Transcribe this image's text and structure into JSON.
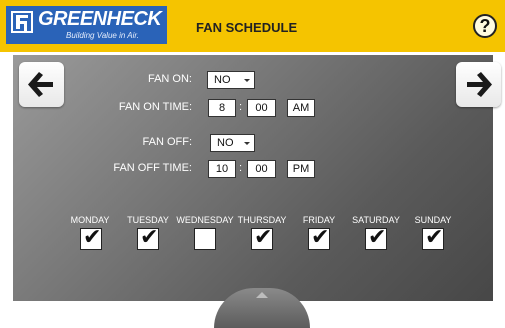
{
  "header": {
    "brand": "GREENHECK",
    "tagline": "Building Value in Air.",
    "title": "FAN SCHEDULE",
    "help_label": "?"
  },
  "colors": {
    "header_bg": "#f5c400",
    "logo_bg": "#2a63b8",
    "panel_dark": "#474747",
    "panel_light": "#9a9a9a"
  },
  "icons": {
    "back": "arrow-left-icon",
    "forward": "arrow-right-icon",
    "help": "question-icon",
    "check": "checkmark-icon"
  },
  "schedule": {
    "fan_on": {
      "label": "FAN ON:",
      "value": "NO"
    },
    "fan_on_time": {
      "label": "FAN ON TIME:",
      "hour": "8",
      "minute": "00",
      "ampm": "AM"
    },
    "fan_off": {
      "label": "FAN OFF:",
      "value": "NO"
    },
    "fan_off_time": {
      "label": "FAN OFF TIME:",
      "hour": "10",
      "minute": "00",
      "ampm": "PM"
    },
    "colon": ":"
  },
  "days": [
    {
      "label": "MONDAY",
      "checked": true
    },
    {
      "label": "TUESDAY",
      "checked": true
    },
    {
      "label": "WEDNESDAY",
      "checked": false
    },
    {
      "label": "THURSDAY",
      "checked": true
    },
    {
      "label": "FRIDAY",
      "checked": true
    },
    {
      "label": "SATURDAY",
      "checked": true
    },
    {
      "label": "SUNDAY",
      "checked": true
    }
  ],
  "check_glyph": "✔"
}
